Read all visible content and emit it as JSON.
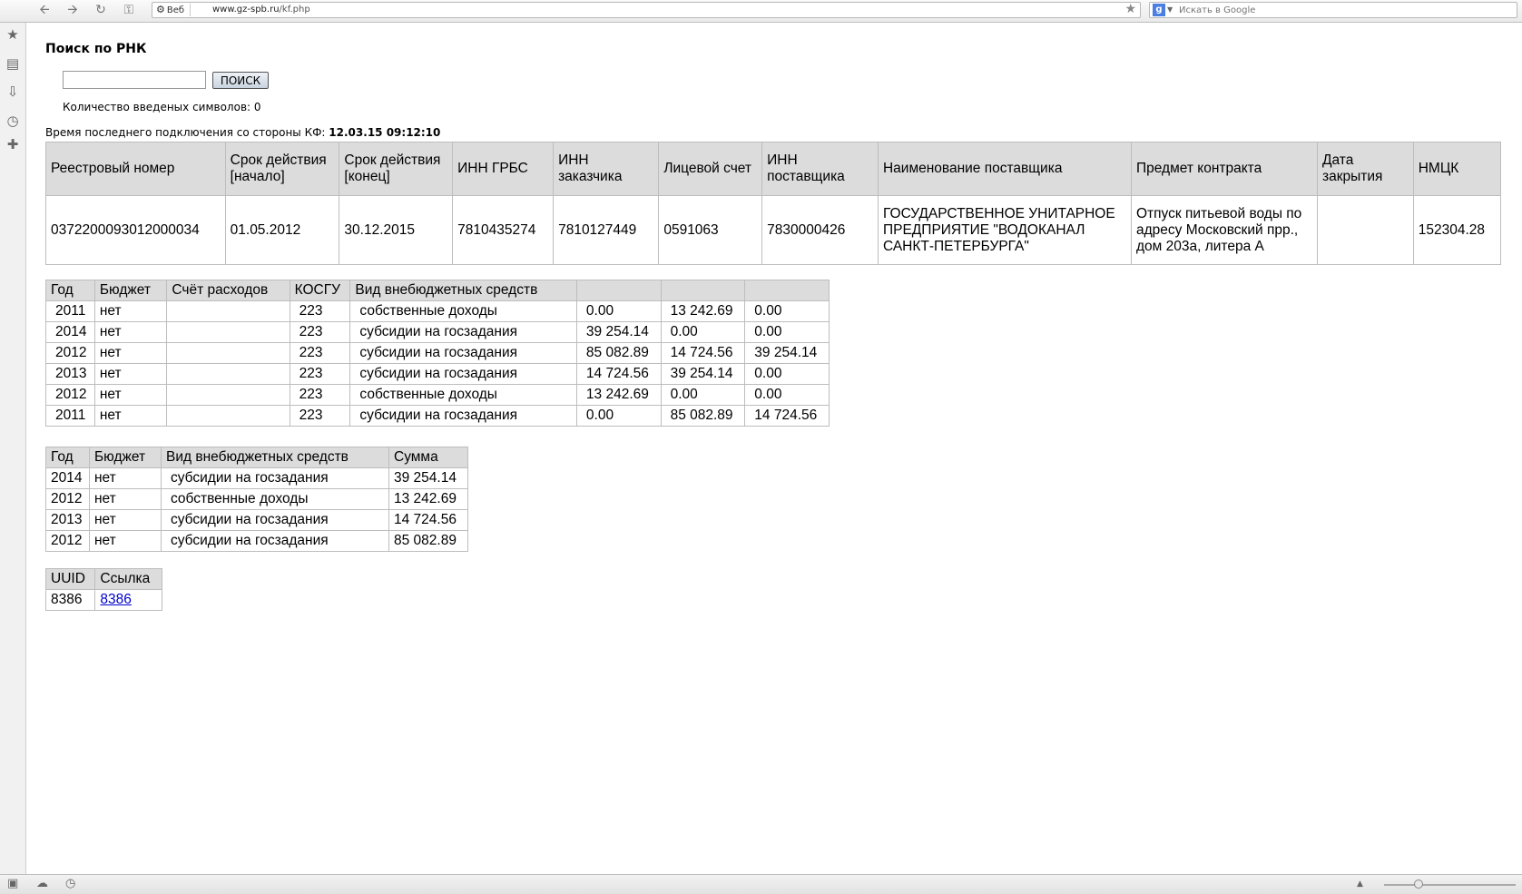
{
  "browser": {
    "web_label": "Веб",
    "url_host": "www.gz-spb.ru",
    "url_path": "/kf.php",
    "search_placeholder": "Искать в Google"
  },
  "page": {
    "title": "Поиск по РНК",
    "search_button": "ПОИСК",
    "search_value": "",
    "char_count": "Количество введеных символов: 0",
    "last_conn_label": "Время последнего подключения со стороны КФ:",
    "last_conn_value": "12.03.15 09:12:10"
  },
  "contract_table": {
    "headers": [
      "Реестровый номер",
      "Срок действия [начало]",
      "Срок действия [конец]",
      "ИНН ГРБС",
      "ИНН заказчика",
      "Лицевой счет",
      "ИНН поставщика",
      "Наименование поставщика",
      "Предмет контракта",
      "Дата закрытия",
      "НМЦК"
    ],
    "row": [
      "0372200093012000034",
      "01.05.2012",
      "30.12.2015",
      "7810435274",
      "7810127449",
      "0591063",
      "7830000426",
      "ГОСУДАРСТВЕННОЕ УНИТАРНОЕ ПРЕДПРИЯТИЕ \"ВОДОКАНАЛ САНКТ-ПЕТЕРБУРГА\"",
      "Отпуск питьевой воды по адресу Московский прр., дом 203а, литера А",
      "",
      "152304.28"
    ]
  },
  "finance_table": {
    "headers": [
      "Год",
      "Бюджет",
      "Счёт расходов",
      "КОСГУ",
      "Вид внебюджетных средств",
      "",
      "",
      ""
    ],
    "rows": [
      [
        "2011",
        "нет",
        "",
        "223",
        "собственные доходы",
        "0.00",
        "13 242.69",
        "0.00"
      ],
      [
        "2014",
        "нет",
        "",
        "223",
        "субсидии на госзадания",
        "39 254.14",
        "0.00",
        "0.00"
      ],
      [
        "2012",
        "нет",
        "",
        "223",
        "субсидии на госзадания",
        "85 082.89",
        "14 724.56",
        "39 254.14"
      ],
      [
        "2013",
        "нет",
        "",
        "223",
        "субсидии на госзадания",
        "14 724.56",
        "39 254.14",
        "0.00"
      ],
      [
        "2012",
        "нет",
        "",
        "223",
        "собственные доходы",
        "13 242.69",
        "0.00",
        "0.00"
      ],
      [
        "2011",
        "нет",
        "",
        "223",
        "субсидии на госзадания",
        "0.00",
        "85 082.89",
        "14 724.56"
      ]
    ]
  },
  "summary_table": {
    "headers": [
      "Год",
      "Бюджет",
      "Вид внебюджетных средств",
      "Сумма"
    ],
    "rows": [
      [
        "2014",
        "нет",
        "субсидии на госзадания",
        "39 254.14"
      ],
      [
        "2012",
        "нет",
        "собственные доходы",
        "13 242.69"
      ],
      [
        "2013",
        "нет",
        "субсидии на госзадания",
        "14 724.56"
      ],
      [
        "2012",
        "нет",
        "субсидии на госзадания",
        "85 082.89"
      ]
    ]
  },
  "uuid_table": {
    "headers": [
      "UUID",
      "Ссылка"
    ],
    "rows": [
      [
        "8386",
        "8386"
      ]
    ]
  }
}
